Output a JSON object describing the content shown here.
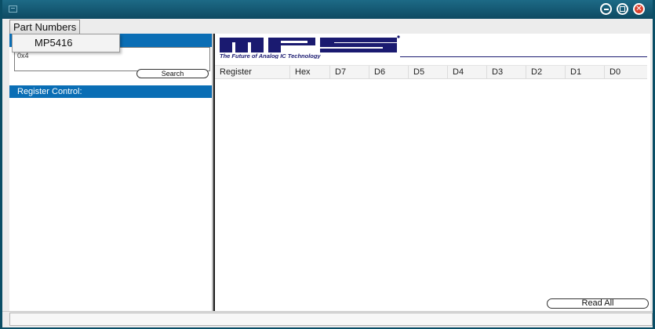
{
  "window": {
    "title": "",
    "controls": [
      "minimize-icon",
      "maximize-icon",
      "close-icon"
    ]
  },
  "menu": {
    "part_numbers_label": "Part Numbers"
  },
  "dropdown": {
    "items": [
      "MP5416"
    ]
  },
  "left_panel": {
    "search_value": "0x4",
    "search_button_label": "Search",
    "register_control_header": "Register Control:"
  },
  "logo": {
    "name": "MPS",
    "tagline": "The Future of Analog IC Technology"
  },
  "table": {
    "columns": [
      "Register",
      "Hex",
      "D7",
      "D6",
      "D5",
      "D4",
      "D3",
      "D2",
      "D1",
      "D0"
    ]
  },
  "read_all_label": "Read All",
  "colors": {
    "titlebar": "#0e4a62",
    "header_blue": "#0a6eb5",
    "logo_navy": "#1a1a70"
  }
}
